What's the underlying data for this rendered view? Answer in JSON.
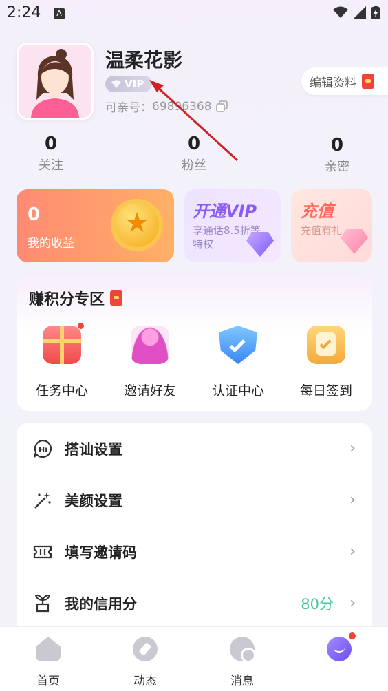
{
  "status_bar": {
    "time": "2:24",
    "a_badge": "A"
  },
  "profile": {
    "nickname": "温柔花影",
    "vip_label": "VIP",
    "id_label": "可亲号：",
    "id_value": "69896368",
    "edit_button": "编辑资料"
  },
  "stats": [
    {
      "value": "0",
      "label": "关注"
    },
    {
      "value": "0",
      "label": "粉丝"
    },
    {
      "value": "0",
      "label": "亲密"
    }
  ],
  "cards": {
    "earnings": {
      "value": "0",
      "label": "我的收益"
    },
    "vip": {
      "title": "开通VIP",
      "subtitle": "享通话8.5折等特权"
    },
    "recharge": {
      "title": "充值",
      "subtitle": "充值有礼"
    }
  },
  "points_zone": {
    "title": "赚积分专区",
    "items": [
      {
        "label": "任务中心",
        "icon": "gift-icon"
      },
      {
        "label": "邀请好友",
        "icon": "invite-icon"
      },
      {
        "label": "认证中心",
        "icon": "shield-check-icon"
      },
      {
        "label": "每日签到",
        "icon": "checkin-icon"
      }
    ]
  },
  "menu": [
    {
      "label": "搭讪设置",
      "icon": "hi-chat-icon",
      "value": ""
    },
    {
      "label": "美颜设置",
      "icon": "magic-wand-icon",
      "value": ""
    },
    {
      "label": "填写邀请码",
      "icon": "ticket-icon",
      "value": ""
    },
    {
      "label": "我的信用分",
      "icon": "sprout-icon",
      "value": "80分"
    }
  ],
  "tabs": [
    {
      "label": "首页",
      "icon": "home-icon"
    },
    {
      "label": "动态",
      "icon": "compass-icon"
    },
    {
      "label": "消息",
      "icon": "chat-icon"
    },
    {
      "label": "",
      "icon": "profile-smile-icon"
    }
  ],
  "colors": {
    "accent_purple": "#8a5cf5",
    "credit_green": "#4ec5a0",
    "badge_red": "#f04438",
    "annotation_arrow": "#d02020"
  }
}
